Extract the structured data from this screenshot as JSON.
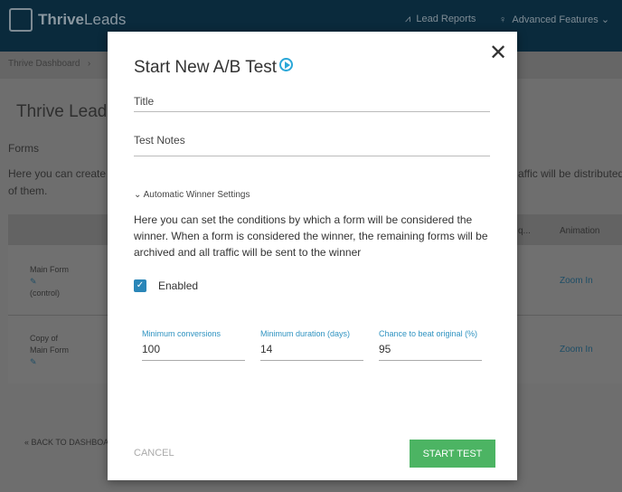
{
  "header": {
    "brand_bold": "Thrive",
    "brand_light": "Leads",
    "nav": [
      {
        "label": "Lead Reports",
        "icon": "chart-icon"
      },
      {
        "label": "Advanced Features",
        "icon": "lightbulb-icon"
      }
    ]
  },
  "breadcrumb": {
    "first": "Thrive Dashboard",
    "sep": "›"
  },
  "page": {
    "title": "Thrive Lead",
    "section": "Forms",
    "desc_left": "Here you can create",
    "desc_right": "affic will be distributed",
    "desc_line2": "of them.",
    "col_partial": "q...",
    "col_animation": "Animation",
    "rows": [
      {
        "name": "Main Form",
        "sub": "(control)",
        "animation": "Zoom In"
      },
      {
        "name1": "Copy of",
        "name2": "Main Form",
        "animation": "Zoom In"
      }
    ],
    "back": "« BACK TO DASHBOA"
  },
  "modal": {
    "title": "Start New A/B Test",
    "title_placeholder": "Title",
    "notes_placeholder": "Test Notes",
    "auto_winner": "Automatic Winner Settings",
    "description": "Here you can set the conditions by which a form will be considered the winner. When a form is considered the winner, the remaining forms will be archived and all traffic will be sent to the winner",
    "enabled_label": "Enabled",
    "enabled": true,
    "fields": [
      {
        "label": "Minimum conversions",
        "value": "100"
      },
      {
        "label": "Minimum duration (days)",
        "value": "14"
      },
      {
        "label": "Chance to beat original (%)",
        "value": "95"
      }
    ],
    "cancel": "CANCEL",
    "start": "START TEST",
    "accent": "#2aa7d8",
    "start_color": "#4cb463"
  }
}
